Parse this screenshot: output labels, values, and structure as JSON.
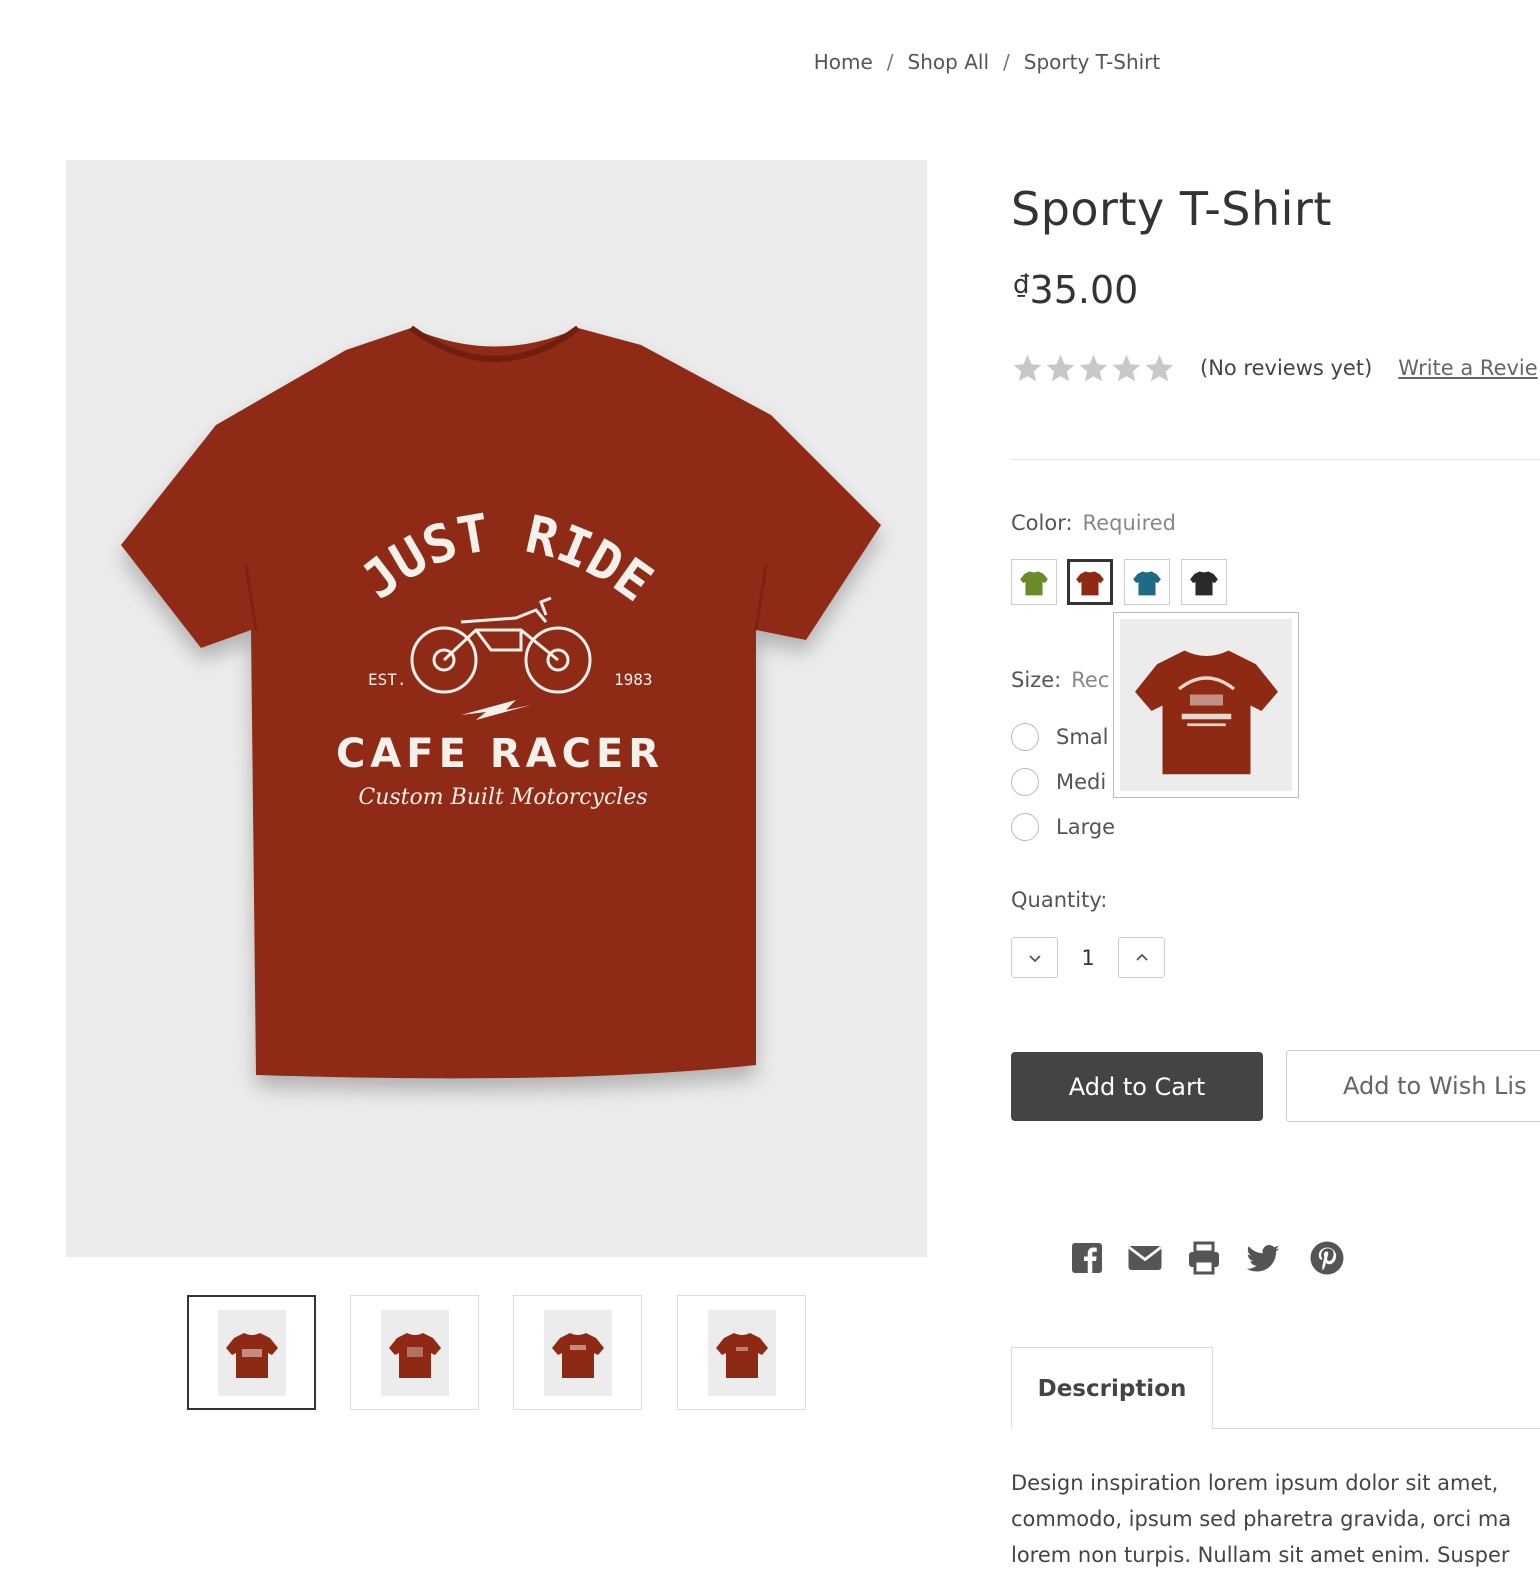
{
  "breadcrumb": {
    "items": [
      "Home",
      "Shop All",
      "Sporty T-Shirt"
    ],
    "separator": "/"
  },
  "product": {
    "title": "Sporty T-Shirt",
    "currency_symbol": "₫",
    "price": "35.00",
    "rating": {
      "stars_filled": 0,
      "stars_total": 5,
      "reviews_text": "(No reviews yet)",
      "write_review_label": "Write a Revie"
    },
    "shirt_graphic": {
      "line1": "JUST RIDE",
      "est_label": "EST.",
      "year": "1983",
      "line2": "CAFE RACER",
      "line3": "Custom Built Motorcycles"
    }
  },
  "color_option": {
    "label": "Color:",
    "required_text": "Required",
    "swatches": [
      {
        "name": "green",
        "color": "#6b8a28",
        "selected": false
      },
      {
        "name": "red",
        "color": "#8e2a14",
        "selected": true
      },
      {
        "name": "teal",
        "color": "#1f6b84",
        "selected": false
      },
      {
        "name": "black",
        "color": "#2a2a2a",
        "selected": false
      }
    ]
  },
  "size_option": {
    "label": "Size:",
    "required_text": "Rec",
    "options": [
      "Smal",
      "Medi",
      "Large"
    ]
  },
  "quantity": {
    "label": "Quantity:",
    "value": "1"
  },
  "buttons": {
    "add_to_cart": "Add to Cart",
    "add_to_wishlist": "Add to Wish Lis"
  },
  "share_icons": [
    "facebook-icon",
    "email-icon",
    "print-icon",
    "twitter-icon",
    "pinterest-icon"
  ],
  "tabs": {
    "description_label": "Description"
  },
  "description_lines": [
    "Design inspiration lorem ipsum dolor sit amet,",
    "commodo, ipsum sed pharetra gravida, orci ma",
    "lorem non turpis. Nullam sit amet enim. Susper"
  ],
  "colors": {
    "shirt": "#8e2a14",
    "dark_button": "#444444",
    "image_bg": "#ececec",
    "star": "#c8c8c8"
  }
}
